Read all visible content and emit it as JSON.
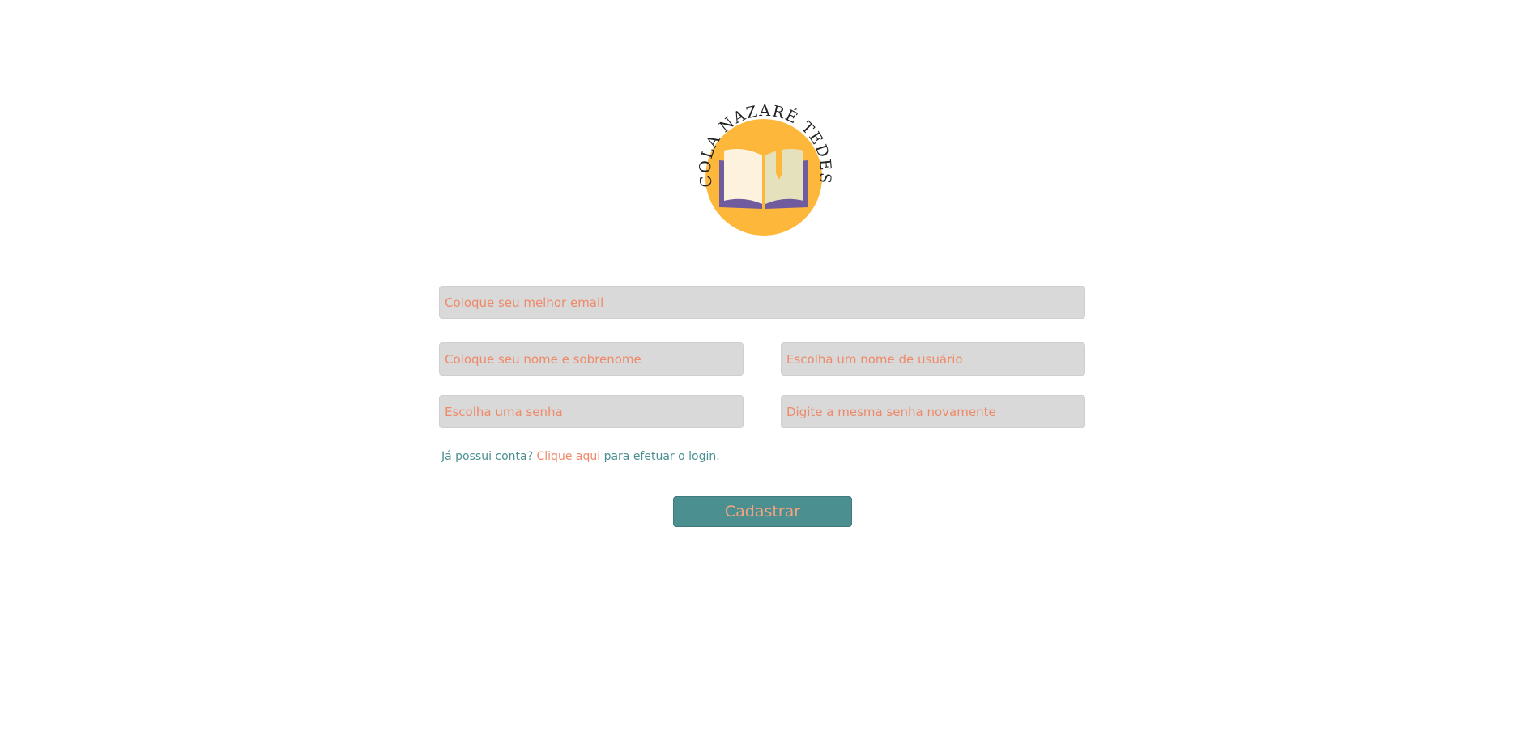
{
  "logo": {
    "name": "school-logo",
    "text": "ESCOLA NAZARÉ TEDESCO",
    "colors": {
      "circle": "#fdb83c",
      "book_cover": "#6f5b9e",
      "page_left": "#fdf2dd",
      "page_right": "#e6e1bd",
      "bookmark": "#fdb83c"
    }
  },
  "form": {
    "email_placeholder": "Coloque seu melhor email",
    "name_placeholder": "Coloque seu nome e sobrenome",
    "username_placeholder": "Escolha um nome de usuário",
    "password_placeholder": "Escolha uma senha",
    "password_confirm_placeholder": "Digite a mesma senha novamente",
    "login_hint": {
      "prefix": "Já possui conta?",
      "link": "Clique aqui",
      "suffix": "para efetuar o login."
    },
    "submit_label": "Cadastrar"
  },
  "colors": {
    "accent": "#4b8f91",
    "placeholder": "#ee8a6a",
    "field_bg": "#d9d9d9"
  }
}
